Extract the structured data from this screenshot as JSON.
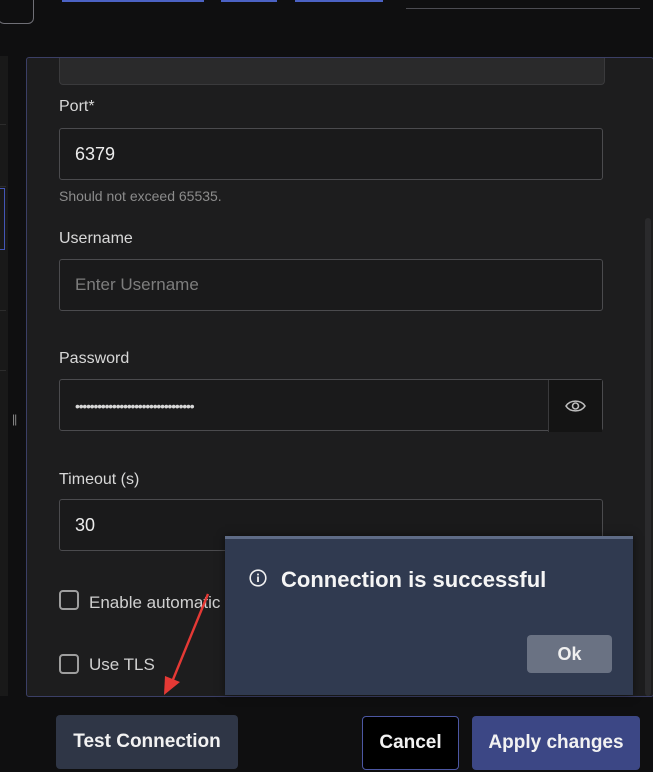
{
  "form": {
    "port": {
      "label": "Port*",
      "value": "6379",
      "hint": "Should not exceed 65535."
    },
    "username": {
      "label": "Username",
      "placeholder": "Enter Username"
    },
    "password": {
      "label": "Password",
      "masked_value": "••••••••••••••••••••••••••••••••",
      "toggle_icon": "eye-icon"
    },
    "timeout": {
      "label": "Timeout (s)",
      "value": "30"
    },
    "auto_discovery": {
      "label": "Enable automatic data decompression",
      "checked": false
    },
    "tls": {
      "label": "Use TLS",
      "checked": false
    }
  },
  "footer": {
    "test_label": "Test Connection",
    "cancel_label": "Cancel",
    "apply_label": "Apply changes"
  },
  "toast": {
    "icon": "info-icon",
    "title": "Connection is successful",
    "ok_label": "Ok"
  },
  "colors": {
    "accent": "#3c4785",
    "panel_border": "#3b3f66",
    "toast_bg": "#303a50",
    "annotation_arrow": "#e53935"
  }
}
